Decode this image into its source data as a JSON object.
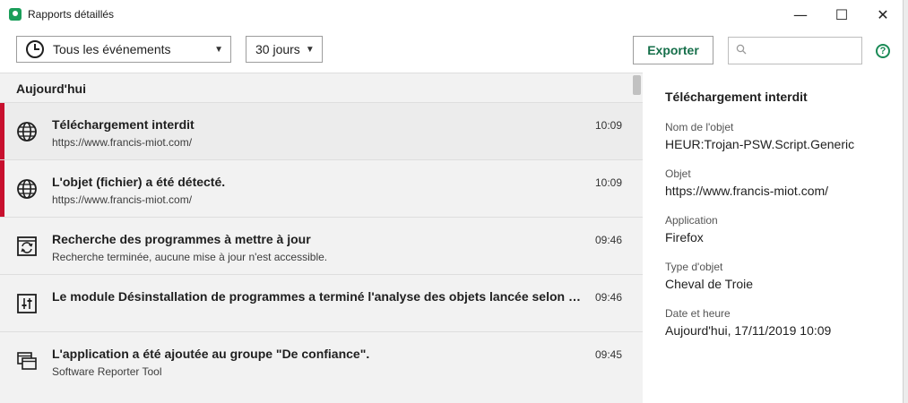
{
  "window": {
    "title": "Rapports détaillés",
    "minimize_glyph": "—",
    "maximize_glyph": "☐",
    "close_glyph": "✕"
  },
  "toolbar": {
    "events_filter": "Tous les événements",
    "period_filter": "30 jours",
    "export_label": "Exporter",
    "search_placeholder": "",
    "help_glyph": "?"
  },
  "list": {
    "section_title": "Aujourd'hui",
    "events": [
      {
        "icon": "globe-icon",
        "title": "Téléchargement interdit",
        "subtitle": "https://www.francis-miot.com/",
        "time": "10:09",
        "severity": "danger"
      },
      {
        "icon": "globe-icon",
        "title": "L'objet (fichier) a été détecté.",
        "subtitle": "https://www.francis-miot.com/",
        "time": "10:09",
        "severity": "danger"
      },
      {
        "icon": "update-icon",
        "title": "Recherche des programmes à mettre à jour",
        "subtitle": "Recherche terminée, aucune mise à jour n'est accessible.",
        "time": "09:46",
        "severity": "info"
      },
      {
        "icon": "sliders-icon",
        "title": "Le module Désinstallation de programmes a terminé l'analyse des objets lancée selon la pr...",
        "subtitle": "",
        "time": "09:46",
        "severity": "info"
      },
      {
        "icon": "app-windows-icon",
        "title": "L'application a été ajoutée au groupe \"De confiance\".",
        "subtitle": "Software Reporter Tool",
        "time": "09:45",
        "severity": "info"
      }
    ]
  },
  "detail": {
    "title": "Téléchargement interdit",
    "fields": [
      {
        "label": "Nom de l'objet",
        "value": "HEUR:Trojan-PSW.Script.Generic"
      },
      {
        "label": "Objet",
        "value": "https://www.francis-miot.com/"
      },
      {
        "label": "Application",
        "value": "Firefox"
      },
      {
        "label": "Type d'objet",
        "value": "Cheval de Troie"
      },
      {
        "label": "Date et heure",
        "value": "Aujourd'hui, 17/11/2019 10:09"
      }
    ]
  },
  "colors": {
    "accent": "#166f4a",
    "danger": "#c8102e",
    "list_bg": "#f2f2f2"
  }
}
